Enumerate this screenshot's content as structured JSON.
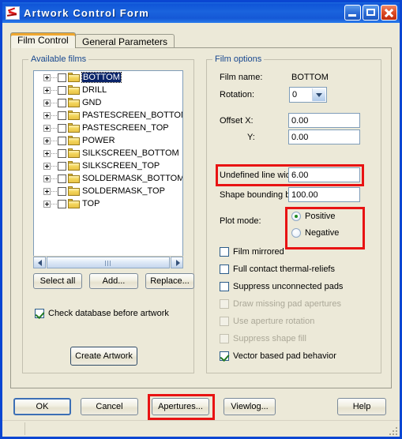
{
  "window": {
    "title": "Artwork Control Form",
    "icon": "artwork-app-icon",
    "minimize_label": "",
    "maximize_label": "",
    "close_label": ""
  },
  "tabs": [
    {
      "label": "Film Control",
      "active": true
    },
    {
      "label": "General Parameters",
      "active": false
    }
  ],
  "available_films": {
    "legend": "Available films",
    "items": [
      {
        "label": "BOTTOM",
        "checked": false,
        "selected": true
      },
      {
        "label": "DRILL",
        "checked": false,
        "selected": false
      },
      {
        "label": "GND",
        "checked": false,
        "selected": false
      },
      {
        "label": "PASTESCREEN_BOTTOM",
        "checked": false,
        "selected": false
      },
      {
        "label": "PASTESCREEN_TOP",
        "checked": false,
        "selected": false
      },
      {
        "label": "POWER",
        "checked": false,
        "selected": false
      },
      {
        "label": "SILKSCREEN_BOTTOM",
        "checked": false,
        "selected": false
      },
      {
        "label": "SILKSCREEN_TOP",
        "checked": false,
        "selected": false
      },
      {
        "label": "SOLDERMASK_BOTTOM",
        "checked": false,
        "selected": false
      },
      {
        "label": "SOLDERMASK_TOP",
        "checked": false,
        "selected": false
      },
      {
        "label": "TOP",
        "checked": false,
        "selected": false
      }
    ],
    "buttons": {
      "select_all": "Select all",
      "add": "Add...",
      "replace": "Replace..."
    },
    "check_database": {
      "label": "Check database before artwork",
      "checked": true
    },
    "create_artwork": "Create Artwork"
  },
  "film_options": {
    "legend": "Film options",
    "film_name_label": "Film name:",
    "film_name_value": "BOTTOM",
    "rotation_label": "Rotation:",
    "rotation_value": "0",
    "offset_x_label": "Offset  X:",
    "offset_x_value": "0.00",
    "offset_y_label": "Y:",
    "offset_y_value": "0.00",
    "undefined_line_width_label": "Undefined line width:",
    "undefined_line_width_value": "6.00",
    "shape_bounding_box_label": "Shape bounding box:",
    "shape_bounding_box_value": "100.00",
    "plot_mode_label": "Plot mode:",
    "plot_mode_options": [
      {
        "label": "Positive",
        "selected": true
      },
      {
        "label": "Negative",
        "selected": false
      }
    ],
    "checkboxes": [
      {
        "label": "Film mirrored",
        "checked": false,
        "enabled": true
      },
      {
        "label": "Full contact thermal-reliefs",
        "checked": false,
        "enabled": true
      },
      {
        "label": "Suppress unconnected pads",
        "checked": false,
        "enabled": true
      },
      {
        "label": "Draw missing pad apertures",
        "checked": false,
        "enabled": false
      },
      {
        "label": "Use aperture rotation",
        "checked": false,
        "enabled": false
      },
      {
        "label": "Suppress shape fill",
        "checked": false,
        "enabled": false
      },
      {
        "label": "Vector based pad behavior",
        "checked": true,
        "enabled": true
      }
    ]
  },
  "dialog_buttons": {
    "ok": "OK",
    "cancel": "Cancel",
    "apertures": "Apertures...",
    "viewlog": "Viewlog...",
    "help": "Help"
  },
  "annotations": {
    "highlight_color": "#e81313",
    "boxes": [
      "undefined-line-width-row",
      "plot-mode-radios",
      "apertures-button"
    ]
  },
  "status_bar": {
    "text": ""
  },
  "colors": {
    "title_bar": "#1558d6",
    "window_border": "#0a46d2",
    "dialog_face": "#ece9d8",
    "group_legend": "#17478f",
    "selection": "#0a246a",
    "highlight": "#e81313"
  }
}
